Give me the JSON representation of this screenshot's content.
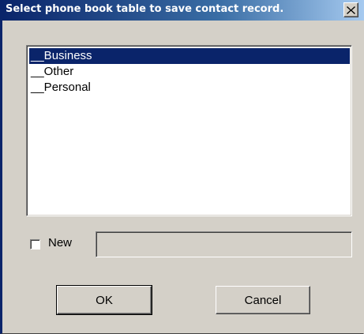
{
  "dialog": {
    "title": "Select phone book table to save contact record.",
    "close_icon": "close-icon"
  },
  "list": {
    "items": [
      {
        "label": "__Business",
        "selected": true
      },
      {
        "label": "__Other",
        "selected": false
      },
      {
        "label": "__Personal",
        "selected": false
      }
    ]
  },
  "new_option": {
    "label": "New",
    "checked": false,
    "input_value": ""
  },
  "buttons": {
    "ok_label": "OK",
    "cancel_label": "Cancel"
  },
  "colors": {
    "title_bar": "#0a246a",
    "selection": "#0a246a",
    "dialog_bg": "#d4d0c8"
  }
}
